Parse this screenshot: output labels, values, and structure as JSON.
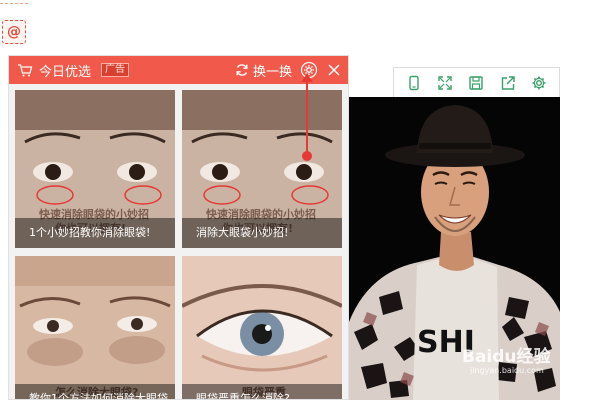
{
  "left_strip": {
    "icon": "at-icon",
    "glyph": "@",
    "accent": "#e74c3c"
  },
  "ad_panel": {
    "title": "今日优选",
    "badge": "广告",
    "refresh_label": "换一换",
    "header_color": "#f15a4a",
    "cards": [
      {
        "caption": "1个小妙招教你消除眼袋!",
        "image_text": "快速消除眼袋的小妙招\n你也可以拥有!"
      },
      {
        "caption": "消除大眼袋小妙招!",
        "image_text": "快速消除眼袋的小妙招\n你也可以拥有!"
      },
      {
        "caption": "教你1个方法如何消除大眼袋",
        "image_text": "怎么消除大眼袋?"
      },
      {
        "caption": "眼袋严重怎么消除?",
        "image_text": "眼袋严重"
      }
    ]
  },
  "viewer_toolbar": {
    "icons": [
      "phone-icon",
      "fullscreen-icon",
      "save-icon",
      "share-icon",
      "settings-icon"
    ],
    "color": "#3aa06a"
  },
  "photo": {
    "subject": "portrait-photo",
    "shirt_text": "SHI"
  },
  "watermark": {
    "main": "Baidu经验",
    "sub": "jingyan.baidu.com"
  },
  "annotation": {
    "color": "#e53935"
  }
}
